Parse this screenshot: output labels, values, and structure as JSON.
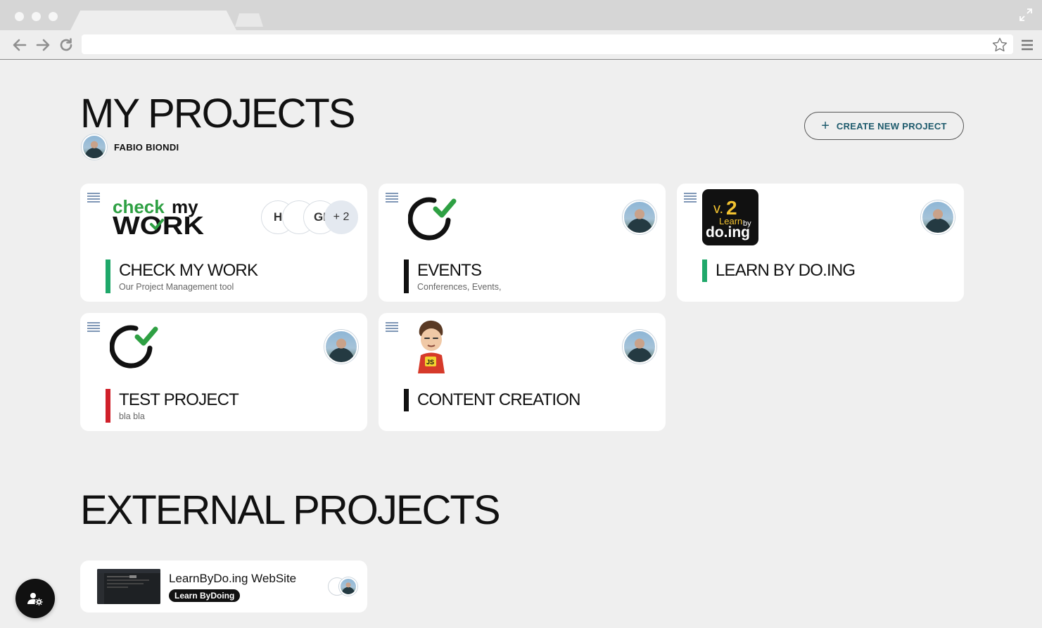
{
  "browser": {
    "address_value": "",
    "icons": [
      "back-arrow-icon",
      "forward-arrow-icon",
      "reload-icon",
      "star-icon",
      "hamburger-menu-icon",
      "expand-icon"
    ]
  },
  "header": {
    "title": "MY PROJECTS",
    "owner_name": "FABIO BIONDI",
    "create_button_label": "CREATE NEW PROJECT",
    "create_button_icon": "plus-icon"
  },
  "projects": [
    {
      "title": "CHECK MY WORK",
      "subtitle": "Our Project Management tool",
      "accent_color": "#1fa86a",
      "logo_text_top": "check",
      "logo_text_my": "my",
      "logo_text_bottom": "WORK",
      "members": [
        "H",
        "",
        "GI",
        "+ 2"
      ]
    },
    {
      "title": "EVENTS",
      "subtitle": "Conferences, Events,",
      "accent_color": "#111111"
    },
    {
      "title": "LEARN BY DO.ING",
      "subtitle": "",
      "accent_color": "#1fa86a",
      "logo_text_version": "v.",
      "logo_text_number": "2",
      "logo_text_learn": "Learn",
      "logo_text_by": "by",
      "logo_text_main": "do.ing"
    },
    {
      "title": "TEST PROJECT",
      "subtitle": "bla bla",
      "accent_color": "#d0202a"
    },
    {
      "title": "CONTENT CREATION",
      "subtitle": "",
      "accent_color": "#111111",
      "logo_text_shirt": "JS"
    }
  ],
  "external": {
    "title": "EXTERNAL PROJECTS",
    "items": [
      {
        "title": "LearnByDo.ing WebSite",
        "badge": "Learn ByDoing"
      }
    ]
  },
  "colors": {
    "background": "#efefef",
    "card": "#ffffff",
    "accent_green": "#1fa86a",
    "accent_red": "#d0202a",
    "button_text": "#1d5a6c",
    "check_green": "#2ea043"
  },
  "fab": {
    "icon": "user-settings-icon"
  }
}
